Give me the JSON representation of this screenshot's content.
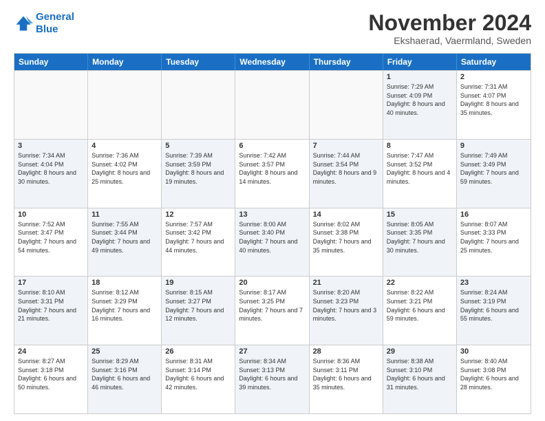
{
  "logo": {
    "line1": "General",
    "line2": "Blue"
  },
  "title": "November 2024",
  "subtitle": "Ekshaerad, Vaermland, Sweden",
  "header_days": [
    "Sunday",
    "Monday",
    "Tuesday",
    "Wednesday",
    "Thursday",
    "Friday",
    "Saturday"
  ],
  "rows": [
    [
      {
        "day": "",
        "info": "",
        "shaded": false,
        "empty": true
      },
      {
        "day": "",
        "info": "",
        "shaded": false,
        "empty": true
      },
      {
        "day": "",
        "info": "",
        "shaded": false,
        "empty": true
      },
      {
        "day": "",
        "info": "",
        "shaded": false,
        "empty": true
      },
      {
        "day": "",
        "info": "",
        "shaded": false,
        "empty": true
      },
      {
        "day": "1",
        "info": "Sunrise: 7:29 AM\nSunset: 4:09 PM\nDaylight: 8 hours\nand 40 minutes.",
        "shaded": true,
        "empty": false
      },
      {
        "day": "2",
        "info": "Sunrise: 7:31 AM\nSunset: 4:07 PM\nDaylight: 8 hours\nand 35 minutes.",
        "shaded": false,
        "empty": false
      }
    ],
    [
      {
        "day": "3",
        "info": "Sunrise: 7:34 AM\nSunset: 4:04 PM\nDaylight: 8 hours\nand 30 minutes.",
        "shaded": true,
        "empty": false
      },
      {
        "day": "4",
        "info": "Sunrise: 7:36 AM\nSunset: 4:02 PM\nDaylight: 8 hours\nand 25 minutes.",
        "shaded": false,
        "empty": false
      },
      {
        "day": "5",
        "info": "Sunrise: 7:39 AM\nSunset: 3:59 PM\nDaylight: 8 hours\nand 19 minutes.",
        "shaded": true,
        "empty": false
      },
      {
        "day": "6",
        "info": "Sunrise: 7:42 AM\nSunset: 3:57 PM\nDaylight: 8 hours\nand 14 minutes.",
        "shaded": false,
        "empty": false
      },
      {
        "day": "7",
        "info": "Sunrise: 7:44 AM\nSunset: 3:54 PM\nDaylight: 8 hours\nand 9 minutes.",
        "shaded": true,
        "empty": false
      },
      {
        "day": "8",
        "info": "Sunrise: 7:47 AM\nSunset: 3:52 PM\nDaylight: 8 hours\nand 4 minutes.",
        "shaded": false,
        "empty": false
      },
      {
        "day": "9",
        "info": "Sunrise: 7:49 AM\nSunset: 3:49 PM\nDaylight: 7 hours\nand 59 minutes.",
        "shaded": true,
        "empty": false
      }
    ],
    [
      {
        "day": "10",
        "info": "Sunrise: 7:52 AM\nSunset: 3:47 PM\nDaylight: 7 hours\nand 54 minutes.",
        "shaded": false,
        "empty": false
      },
      {
        "day": "11",
        "info": "Sunrise: 7:55 AM\nSunset: 3:44 PM\nDaylight: 7 hours\nand 49 minutes.",
        "shaded": true,
        "empty": false
      },
      {
        "day": "12",
        "info": "Sunrise: 7:57 AM\nSunset: 3:42 PM\nDaylight: 7 hours\nand 44 minutes.",
        "shaded": false,
        "empty": false
      },
      {
        "day": "13",
        "info": "Sunrise: 8:00 AM\nSunset: 3:40 PM\nDaylight: 7 hours\nand 40 minutes.",
        "shaded": true,
        "empty": false
      },
      {
        "day": "14",
        "info": "Sunrise: 8:02 AM\nSunset: 3:38 PM\nDaylight: 7 hours\nand 35 minutes.",
        "shaded": false,
        "empty": false
      },
      {
        "day": "15",
        "info": "Sunrise: 8:05 AM\nSunset: 3:35 PM\nDaylight: 7 hours\nand 30 minutes.",
        "shaded": true,
        "empty": false
      },
      {
        "day": "16",
        "info": "Sunrise: 8:07 AM\nSunset: 3:33 PM\nDaylight: 7 hours\nand 25 minutes.",
        "shaded": false,
        "empty": false
      }
    ],
    [
      {
        "day": "17",
        "info": "Sunrise: 8:10 AM\nSunset: 3:31 PM\nDaylight: 7 hours\nand 21 minutes.",
        "shaded": true,
        "empty": false
      },
      {
        "day": "18",
        "info": "Sunrise: 8:12 AM\nSunset: 3:29 PM\nDaylight: 7 hours\nand 16 minutes.",
        "shaded": false,
        "empty": false
      },
      {
        "day": "19",
        "info": "Sunrise: 8:15 AM\nSunset: 3:27 PM\nDaylight: 7 hours\nand 12 minutes.",
        "shaded": true,
        "empty": false
      },
      {
        "day": "20",
        "info": "Sunrise: 8:17 AM\nSunset: 3:25 PM\nDaylight: 7 hours\nand 7 minutes.",
        "shaded": false,
        "empty": false
      },
      {
        "day": "21",
        "info": "Sunrise: 8:20 AM\nSunset: 3:23 PM\nDaylight: 7 hours\nand 3 minutes.",
        "shaded": true,
        "empty": false
      },
      {
        "day": "22",
        "info": "Sunrise: 8:22 AM\nSunset: 3:21 PM\nDaylight: 6 hours\nand 59 minutes.",
        "shaded": false,
        "empty": false
      },
      {
        "day": "23",
        "info": "Sunrise: 8:24 AM\nSunset: 3:19 PM\nDaylight: 6 hours\nand 55 minutes.",
        "shaded": true,
        "empty": false
      }
    ],
    [
      {
        "day": "24",
        "info": "Sunrise: 8:27 AM\nSunset: 3:18 PM\nDaylight: 6 hours\nand 50 minutes.",
        "shaded": false,
        "empty": false
      },
      {
        "day": "25",
        "info": "Sunrise: 8:29 AM\nSunset: 3:16 PM\nDaylight: 6 hours\nand 46 minutes.",
        "shaded": true,
        "empty": false
      },
      {
        "day": "26",
        "info": "Sunrise: 8:31 AM\nSunset: 3:14 PM\nDaylight: 6 hours\nand 42 minutes.",
        "shaded": false,
        "empty": false
      },
      {
        "day": "27",
        "info": "Sunrise: 8:34 AM\nSunset: 3:13 PM\nDaylight: 6 hours\nand 39 minutes.",
        "shaded": true,
        "empty": false
      },
      {
        "day": "28",
        "info": "Sunrise: 8:36 AM\nSunset: 3:11 PM\nDaylight: 6 hours\nand 35 minutes.",
        "shaded": false,
        "empty": false
      },
      {
        "day": "29",
        "info": "Sunrise: 8:38 AM\nSunset: 3:10 PM\nDaylight: 6 hours\nand 31 minutes.",
        "shaded": true,
        "empty": false
      },
      {
        "day": "30",
        "info": "Sunrise: 8:40 AM\nSunset: 3:08 PM\nDaylight: 6 hours\nand 28 minutes.",
        "shaded": false,
        "empty": false
      }
    ]
  ]
}
